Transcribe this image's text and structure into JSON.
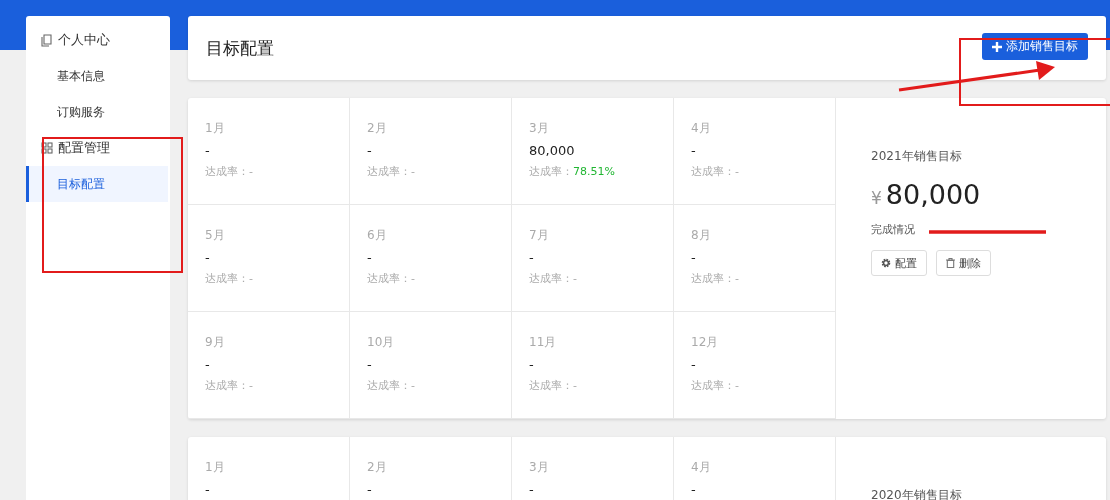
{
  "sidebar": {
    "groups": [
      {
        "label": "个人中心",
        "kind": "document",
        "children": [
          {
            "label": "基本信息",
            "selected": false
          },
          {
            "label": "订购服务",
            "selected": false
          }
        ]
      },
      {
        "label": "配置管理",
        "kind": "grid",
        "children": [
          {
            "label": "目标配置",
            "selected": true
          }
        ]
      }
    ]
  },
  "header": {
    "title": "目标配置",
    "add_button": "添加销售目标"
  },
  "targets": [
    {
      "months": [
        {
          "label": "1月",
          "value": "-",
          "rate_label": "达成率：",
          "rate": "-",
          "highlight": false
        },
        {
          "label": "2月",
          "value": "-",
          "rate_label": "达成率：",
          "rate": "-",
          "highlight": false
        },
        {
          "label": "3月",
          "value": "80,000",
          "rate_label": "达成率：",
          "rate": "78.51%",
          "highlight": true
        },
        {
          "label": "4月",
          "value": "-",
          "rate_label": "达成率：",
          "rate": "-",
          "highlight": false
        },
        {
          "label": "5月",
          "value": "-",
          "rate_label": "达成率：",
          "rate": "-",
          "highlight": false
        },
        {
          "label": "6月",
          "value": "-",
          "rate_label": "达成率：",
          "rate": "-",
          "highlight": false
        },
        {
          "label": "7月",
          "value": "-",
          "rate_label": "达成率：",
          "rate": "-",
          "highlight": false
        },
        {
          "label": "8月",
          "value": "-",
          "rate_label": "达成率：",
          "rate": "-",
          "highlight": false
        },
        {
          "label": "9月",
          "value": "-",
          "rate_label": "达成率：",
          "rate": "-",
          "highlight": false
        },
        {
          "label": "10月",
          "value": "-",
          "rate_label": "达成率：",
          "rate": "-",
          "highlight": false
        },
        {
          "label": "11月",
          "value": "-",
          "rate_label": "达成率：",
          "rate": "-",
          "highlight": false
        },
        {
          "label": "12月",
          "value": "-",
          "rate_label": "达成率：",
          "rate": "-",
          "highlight": false
        }
      ],
      "title": "2021年销售目标",
      "currency": "¥",
      "amount": "80,000",
      "progress_label": "完成情况",
      "config_button": "配置",
      "delete_button": "删除"
    },
    {
      "months": [
        {
          "label": "1月",
          "value": "-"
        },
        {
          "label": "2月",
          "value": "-"
        },
        {
          "label": "3月",
          "value": "-"
        },
        {
          "label": "4月",
          "value": "-"
        }
      ],
      "title": "2020年销售目标"
    }
  ]
}
